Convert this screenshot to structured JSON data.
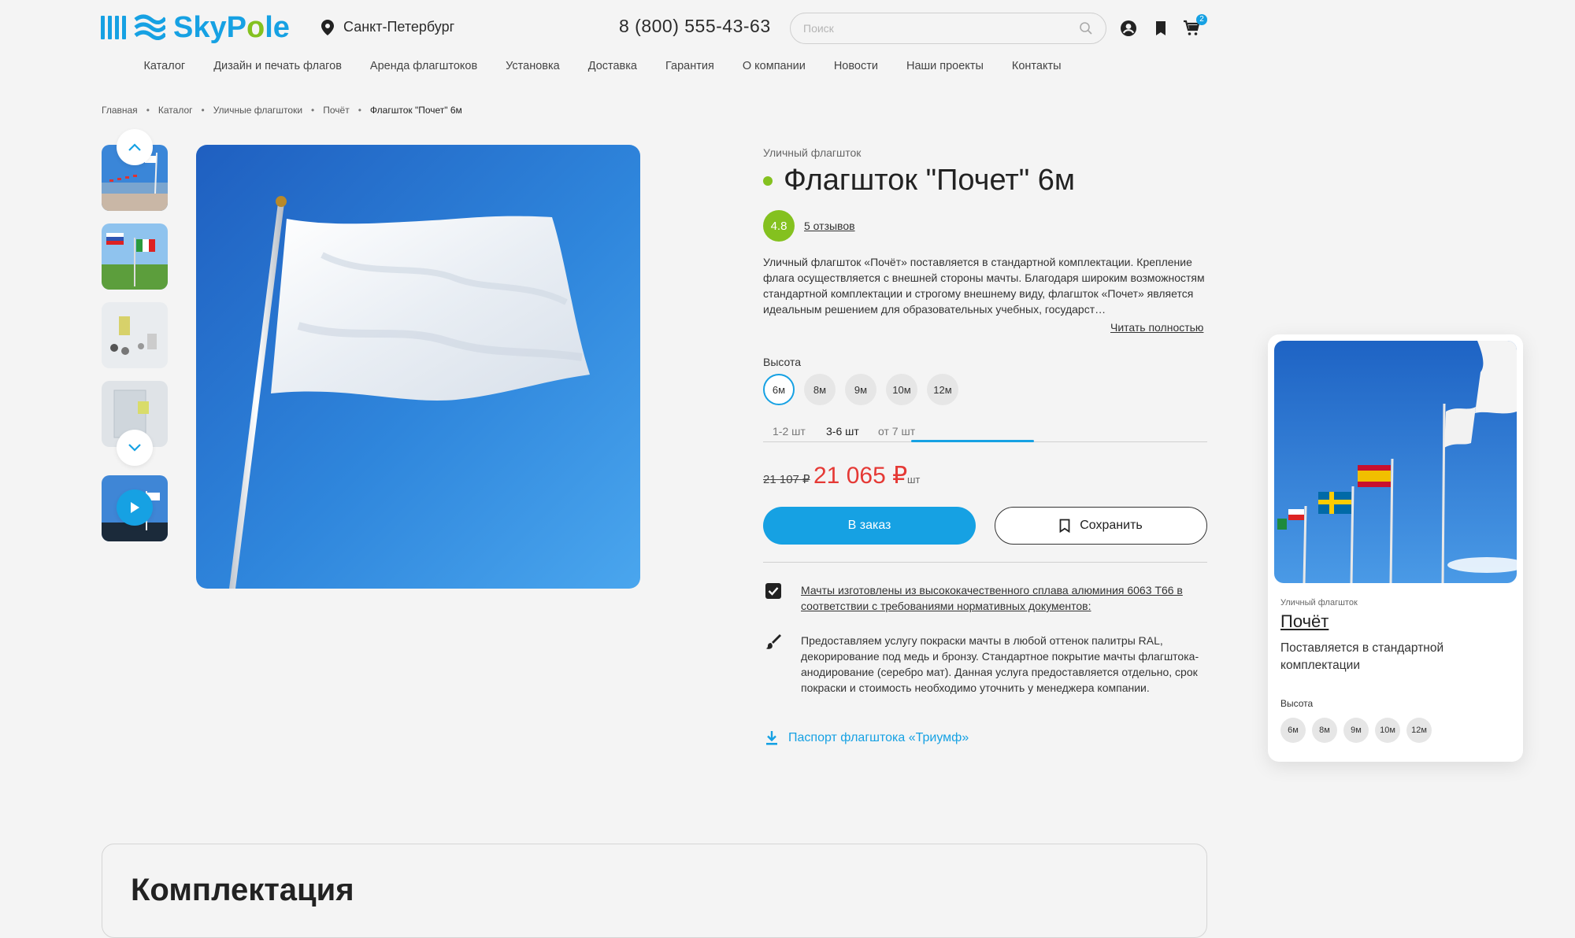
{
  "header": {
    "logo_text_a": "SkyP",
    "logo_text_o": "o",
    "logo_text_b": "le",
    "city": "Санкт-Петербург",
    "phone": "8 (800) 555-43-63",
    "search_placeholder": "Поиск",
    "cart_count": "2"
  },
  "nav": {
    "items": [
      "Каталог",
      "Дизайн и печать флагов",
      "Аренда флагштоков",
      "Установка",
      "Доставка",
      "Гарантия",
      "О компании",
      "Новости",
      "Наши проекты",
      "Контакты"
    ]
  },
  "breadcrumb": {
    "items": [
      "Главная",
      "Каталог",
      "Уличные флагштоки",
      "Почёт"
    ],
    "current": "Флагшток \"Почет\" 6м"
  },
  "product": {
    "type": "Уличный флагшток",
    "title": "Флагшток \"Почет\" 6м",
    "rating": "4.8",
    "reviews": "5 отзывов",
    "description": "Уличный флагшток «Почёт» поставляется в стандартной комплектации. Крепление флага осуществляется с внешней стороны мачты. Благодаря широким возможностям стандартной комплектации и строгому внешнему виду, флагшток «Почет» является идеальным решением для образовательных учебных, государст…",
    "read_more": "Читать полностью",
    "height_label": "Высота",
    "sizes": [
      "6м",
      "8м",
      "9м",
      "10м",
      "12м"
    ],
    "selected_size": "6м",
    "qty_tabs": [
      "1-2 шт",
      "3-6 шт",
      "от 7 шт"
    ],
    "selected_qty_tab": "3-6 шт",
    "old_price": "21 107 ₽",
    "price": "21 065 ₽",
    "unit": "шт",
    "order_button": "В заказ",
    "save_button": "Сохранить",
    "features": [
      "Мачты изготовлены из высококачественного сплава алюминия 6063 Т66 в соответствии с требованиями нормативных документов:",
      "Предоставляем услугу покраски мачты в любой оттенок палитры RAL, декорирование под медь и бронзу. Стандартное покрытие мачты флагштока- анодирование (серебро мат). Данная услуга предоставляется отдельно, срок покраски и стоимость необходимо уточнить у менеджера компании."
    ],
    "passport_link": "Паспорт флагштока «Триумф»"
  },
  "side_card": {
    "type": "Уличный флагшток",
    "title": "Почёт",
    "description": "Поставляется в стандартной комплектации",
    "height_label": "Высота",
    "sizes": [
      "6м",
      "8м",
      "9м",
      "10м",
      "12м"
    ]
  },
  "kit": {
    "title": "Комплектация"
  },
  "colors": {
    "accent": "#16a1e3",
    "green": "#84c11f",
    "price": "#e53935"
  }
}
